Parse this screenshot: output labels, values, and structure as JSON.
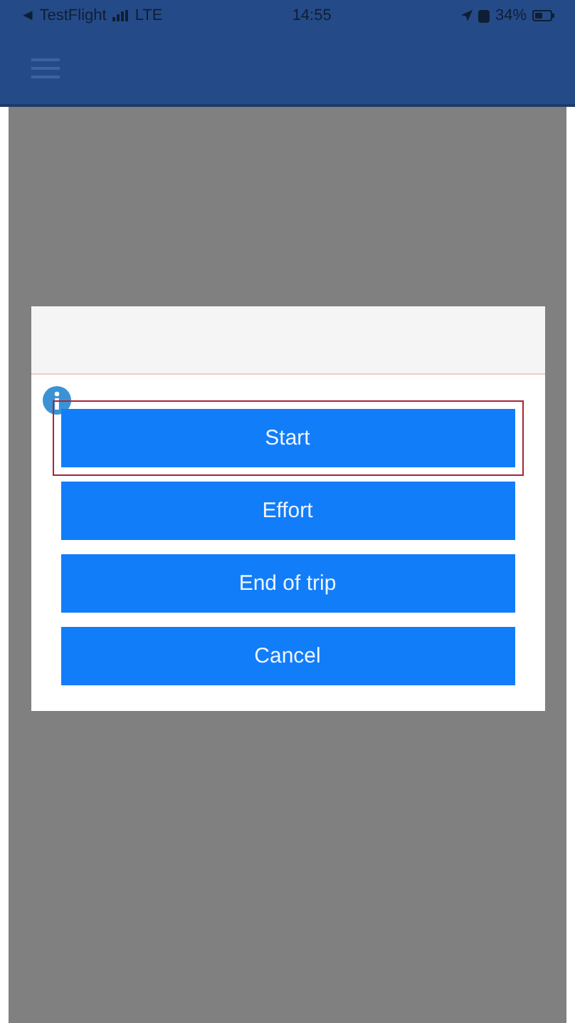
{
  "status_bar": {
    "back_app": "◄ TestFlight",
    "network": "LTE",
    "time": "14:55",
    "battery": "34%"
  },
  "dialog": {
    "buttons": [
      {
        "label": "Start",
        "highlighted": true
      },
      {
        "label": "Effort",
        "highlighted": false
      },
      {
        "label": "End of trip",
        "highlighted": false
      },
      {
        "label": "Cancel",
        "highlighted": false
      }
    ]
  }
}
